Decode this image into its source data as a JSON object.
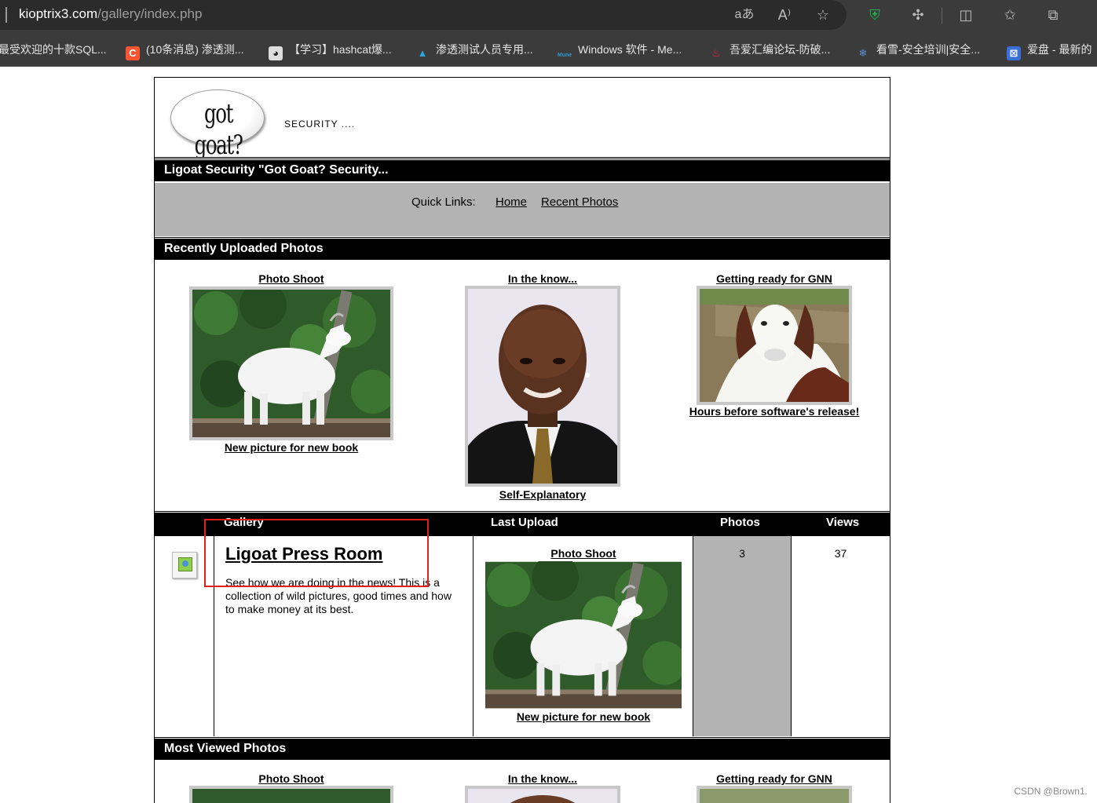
{
  "browser": {
    "url_host": "kioptrix3.com",
    "url_path": "/gallery/index.php",
    "bookmarks": [
      "最受欢迎的十款SQL...",
      "(10条消息) 渗透测...",
      "【学习】hashcat爆...",
      "渗透测试人员专用...",
      "Windows 软件 - Me...",
      "吾爱汇编论坛-防破...",
      "看雪-安全培训|安全...",
      "爱盘 - 最新的"
    ],
    "colors": {
      "chrome": "#3b3b3b",
      "address_bar": "#2b2b2b",
      "shield": "#22b14c"
    }
  },
  "site": {
    "logo_text": "got goat?",
    "tagline": "SECURITY ....",
    "title_bar": "Ligoat Security \"Got Goat? Security...",
    "quick_links": {
      "label": "Quick Links:",
      "home": "Home",
      "recent": "Recent Photos"
    },
    "recent": {
      "heading": "Recently Uploaded Photos",
      "photos": [
        {
          "title": "Photo Shoot",
          "caption": "New picture for new book",
          "image": "white-goat"
        },
        {
          "title": "In the know...",
          "caption": "Self-Explanatory",
          "image": "man-portrait"
        },
        {
          "title": "Getting ready for GNN",
          "caption": "Hours before software's release!",
          "image": "brown-goat"
        }
      ]
    },
    "gallery": {
      "headers": {
        "gallery": "Gallery",
        "last_upload": "Last Upload",
        "photos": "Photos",
        "views": "Views"
      },
      "row": {
        "name": "Ligoat Press Room",
        "description": "See how we are doing in the news! This is a collection of wild pictures, good times and how to make money at its best.",
        "last_upload_title": "Photo Shoot",
        "last_upload_caption": "New picture for new book",
        "photos": "3",
        "views": "37"
      }
    },
    "most_viewed": {
      "heading": "Most Viewed Photos",
      "photos": [
        {
          "title": "Photo Shoot"
        },
        {
          "title": "In the know..."
        },
        {
          "title": "Getting ready for GNN"
        }
      ]
    }
  },
  "watermark": "CSDN @Brown1.",
  "annotation_color": "#e0201a"
}
